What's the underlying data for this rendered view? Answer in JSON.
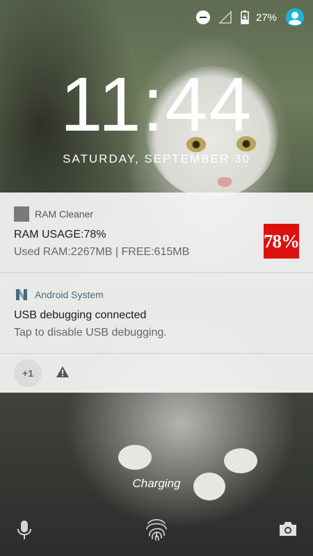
{
  "status_bar": {
    "battery_percent": "27%",
    "icons": [
      "do-not-disturb-icon",
      "no-signal-icon",
      "battery-charging-icon",
      "account-icon"
    ],
    "account_color": "#1bb5d4"
  },
  "lockscreen": {
    "time": "11:44",
    "date": "SATURDAY, SEPTEMBER 30",
    "charging_text": "Charging"
  },
  "notifications": [
    {
      "app_name": "RAM Cleaner",
      "title": "RAM USAGE:78%",
      "text": "Used RAM:2267MB | FREE:615MB",
      "large_icon_text": "78%",
      "large_icon_color": "#e01010"
    },
    {
      "app_name": "Android System",
      "title": "USB debugging connected",
      "text": "Tap to disable USB debugging."
    }
  ],
  "overflow": {
    "more_count": "+1",
    "icons": [
      "warning-icon"
    ]
  },
  "bottom_actions": [
    "mic-icon",
    "fingerprint-icon",
    "camera-icon"
  ]
}
